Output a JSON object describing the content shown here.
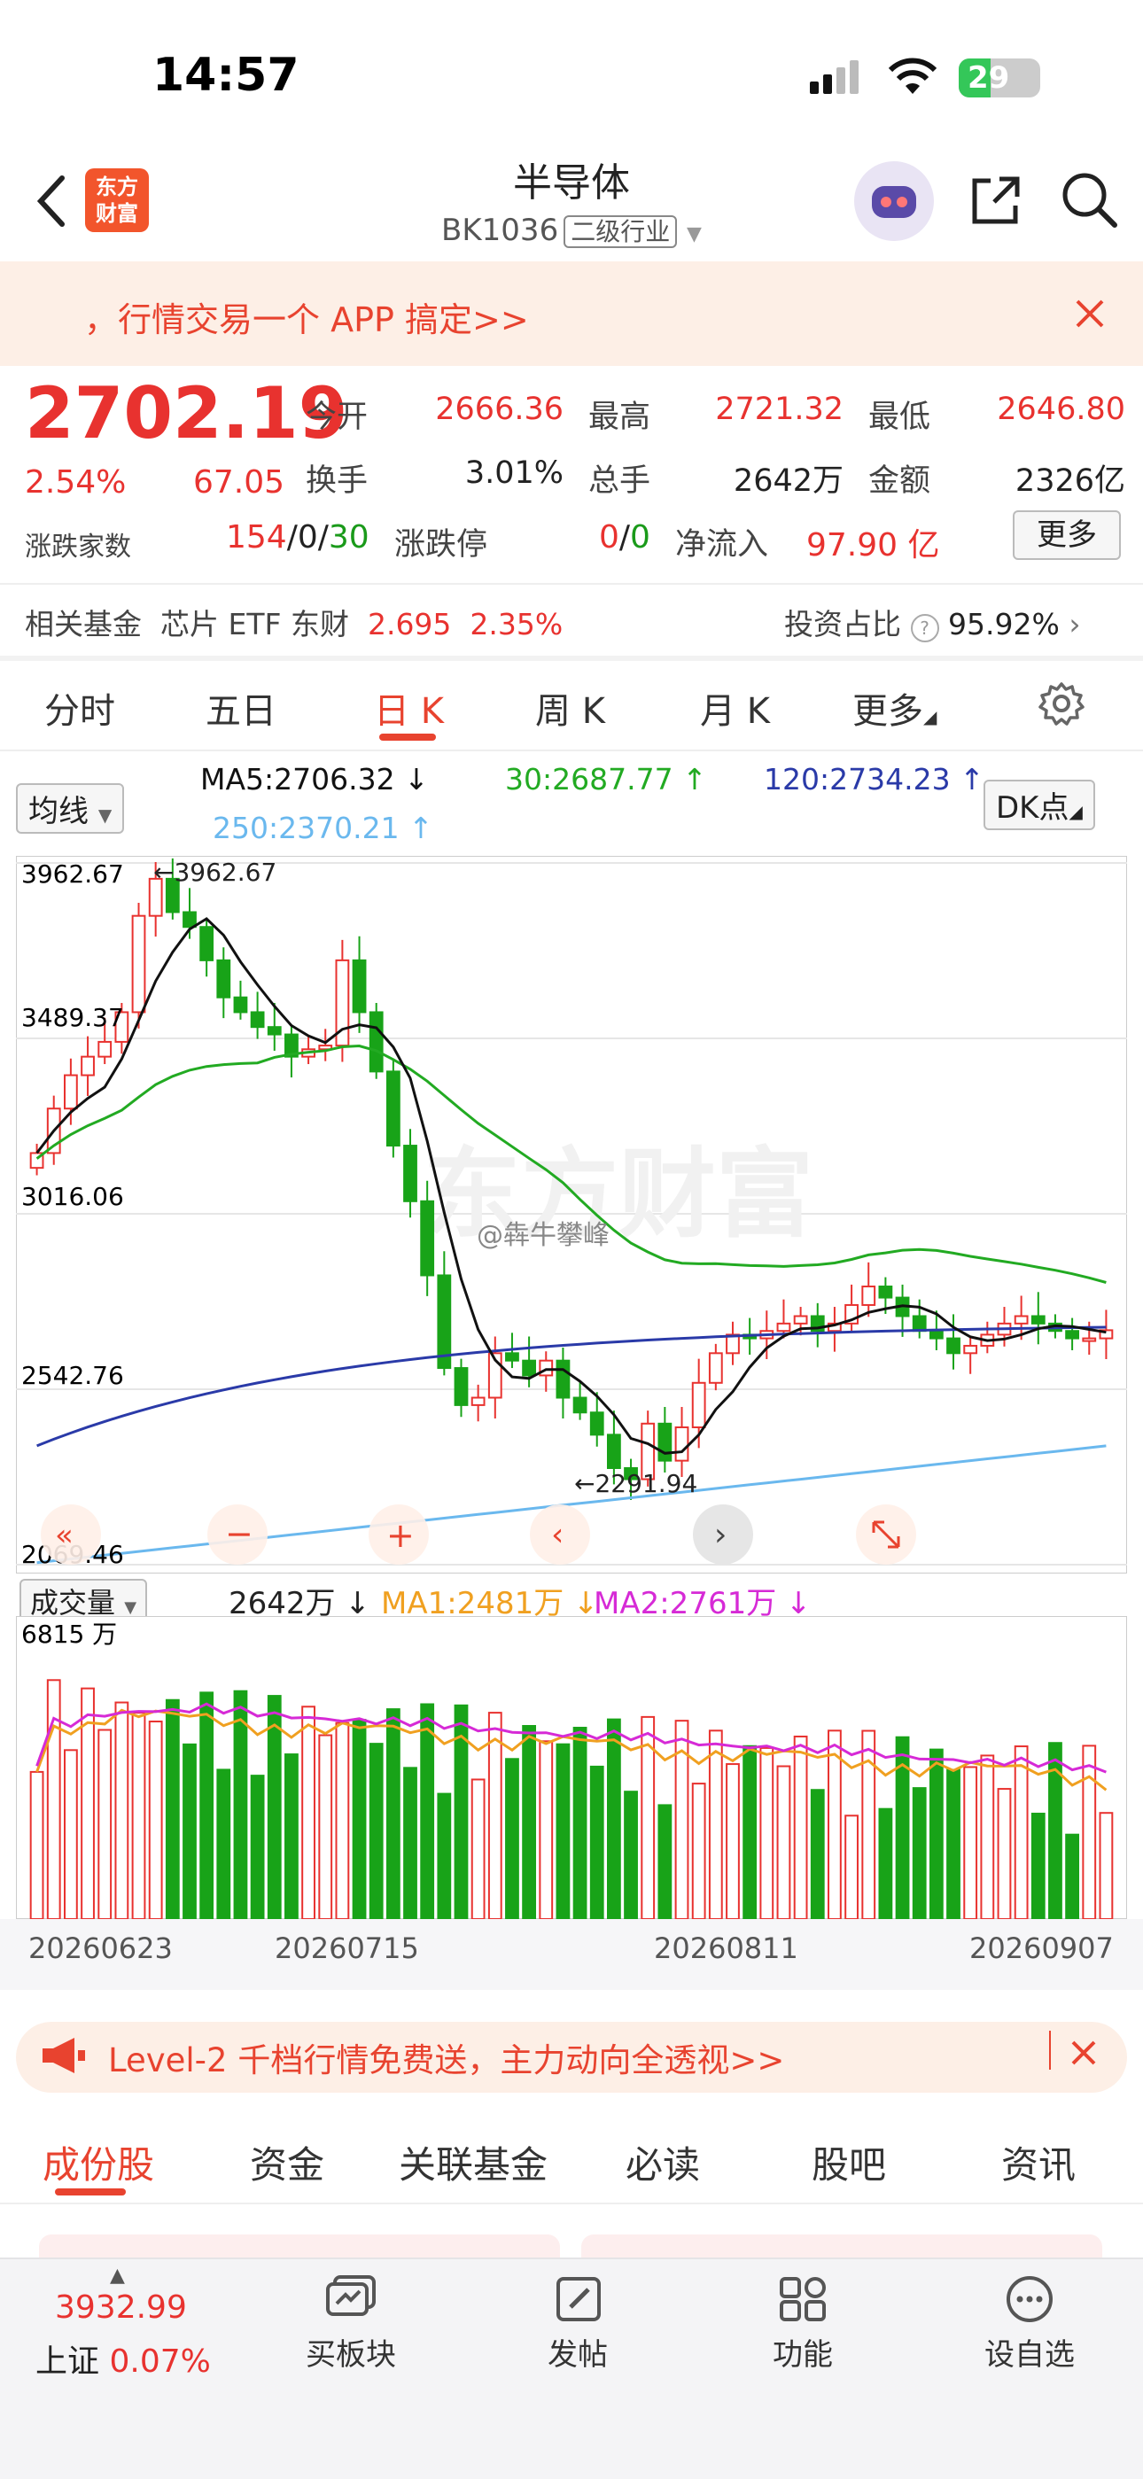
{
  "status": {
    "time": "14:57",
    "battery": "29"
  },
  "header": {
    "title": "半导体",
    "code": "BK1036",
    "tag": "二级行业",
    "logo_text": "东方财富"
  },
  "promo": {
    "text": "，行情交易一个 APP 搞定>>"
  },
  "quote": {
    "price": "2702.19",
    "pct": "2.54%",
    "change": "67.05",
    "open_label": "今开",
    "open": "2666.36",
    "high_label": "最高",
    "high": "2721.32",
    "low_label": "最低",
    "low": "2646.80",
    "turnover_label": "换手",
    "turnover": "3.01%",
    "volume_label": "总手",
    "volume": "2642万",
    "amount_label": "金额",
    "amount": "2326亿",
    "breadth_label": "涨跌家数",
    "breadth_up": "154",
    "breadth_flat": "0",
    "breadth_down": "30",
    "limit_label": "涨跌停",
    "limit_up": "0",
    "limit_down": "0",
    "inflow_label": "净流入",
    "inflow": "97.90 亿",
    "more": "更多"
  },
  "fund": {
    "label": "相关基金",
    "name": "芯片 ETF 东财",
    "price": "2.695",
    "pct": "2.35%",
    "ratio_label": "投资占比",
    "ratio": "95.92%"
  },
  "period_tabs": [
    "分时",
    "五日",
    "日 K",
    "周 K",
    "月 K",
    "更多"
  ],
  "ma_row": {
    "select": "均线",
    "ma5": "MA5:2706.32",
    "ma30": "30:2687.77",
    "ma120": "120:2734.23",
    "ma250": "250:2370.21",
    "dk": "DK点"
  },
  "chart_data": {
    "type": "candlestick",
    "price_ticks": [
      "3962.67",
      "3489.37",
      "3016.06",
      "2542.76",
      "2069.46"
    ],
    "annotations": {
      "high": "3962.67",
      "low": "2291.94"
    },
    "watermark": "东方财富",
    "user_watermark": "@犇牛攀峰",
    "dates": [
      "20260623",
      "20260715",
      "20260811",
      "20260907"
    ],
    "volume": {
      "select": "成交量",
      "value": "2642万",
      "ma1": "MA1:2481万",
      "ma2": "MA2:2761万",
      "max": "6815 万"
    }
  },
  "colors": {
    "up": "#e8322f",
    "down": "#18a318",
    "ma5": "#111111",
    "ma30": "#22aa22",
    "ma120": "#2a3aa8",
    "ma250": "#6ab8ee",
    "accent": "#e8432f"
  },
  "l2banner": {
    "text": "Level-2 千档行情免费送，主力动向全透视>>"
  },
  "bottom_tabs": [
    "成份股",
    "资金",
    "关联基金",
    "必读",
    "股吧",
    "资讯"
  ],
  "bottomnav": {
    "index_value": "3932.99",
    "index_name": "上证",
    "index_pct": "0.07%",
    "items": [
      "买板块",
      "发帖",
      "功能",
      "设自选"
    ]
  }
}
